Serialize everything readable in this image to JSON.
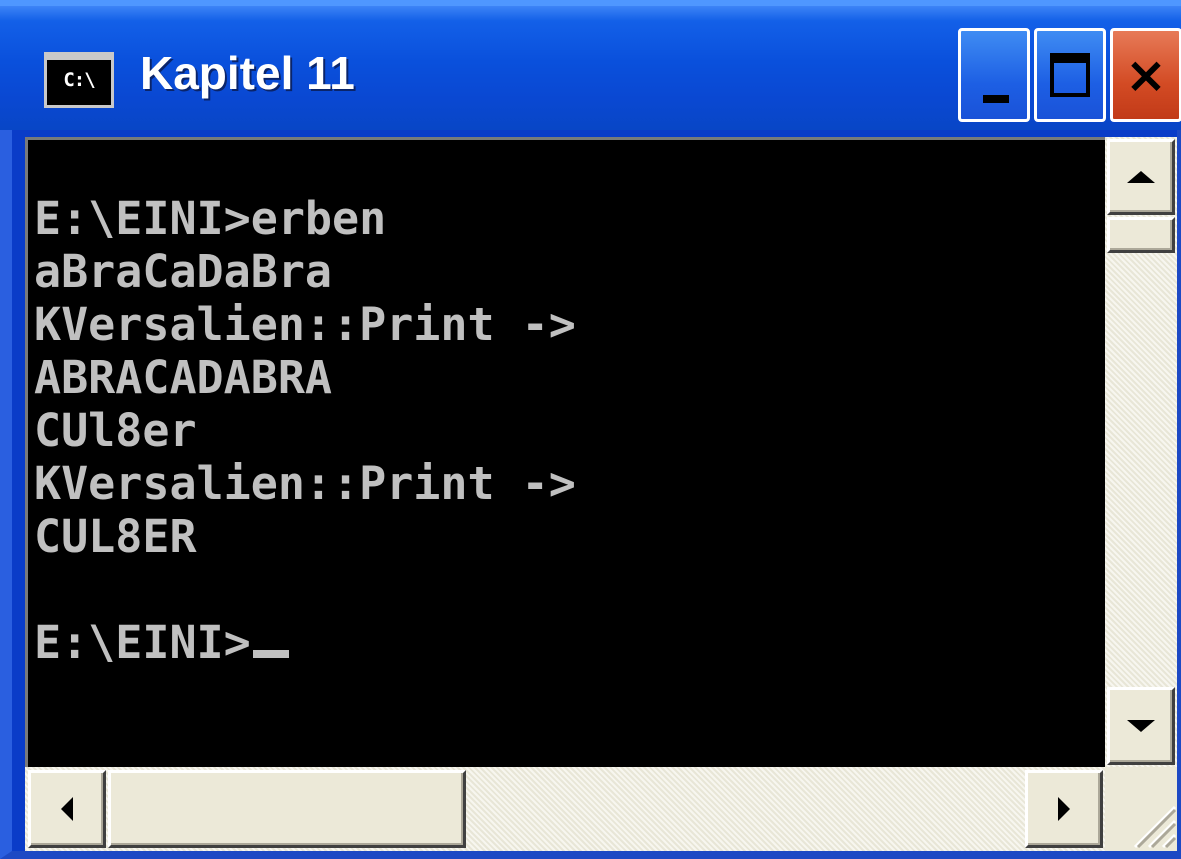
{
  "window": {
    "title": "Kapitel 11",
    "icon_text": "C:\\",
    "icon": "console-window-icon",
    "buttons": [
      "minimize-icon",
      "maximize-icon",
      "close-icon"
    ]
  },
  "console": {
    "lines": [
      "E:\\EINI>erben",
      "aBraCaDaBra",
      "KVersalien::Print ->",
      "ABRACADABRA",
      "CUl8er",
      "KVersalien::Print ->",
      "CUL8ER",
      "",
      "E:\\EINI>"
    ],
    "foreground_color": "#c0c0c0",
    "background_color": "#000000"
  },
  "colors": {
    "titlebar": "#0a50dc",
    "close_button": "#d34b24",
    "chrome": "#ece9d8"
  }
}
